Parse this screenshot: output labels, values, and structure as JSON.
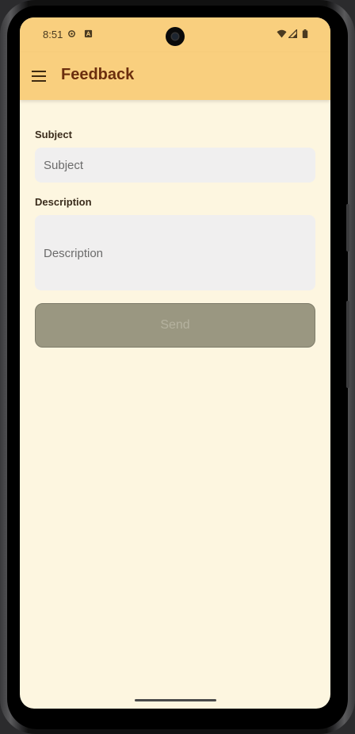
{
  "status_bar": {
    "time": "8:51",
    "left_icons": [
      "settings-icon",
      "accessibility-icon"
    ],
    "right_icons": [
      "wifi-icon",
      "signal-icon",
      "battery-icon"
    ]
  },
  "app_bar": {
    "title": "Feedback",
    "menu_icon": "hamburger-menu-icon"
  },
  "form": {
    "subject": {
      "label": "Subject",
      "placeholder": "Subject",
      "value": ""
    },
    "description": {
      "label": "Description",
      "placeholder": "Description",
      "value": ""
    },
    "send_label": "Send"
  },
  "colors": {
    "app_bar": "#f9cf7e",
    "background": "#fdf6e0",
    "title": "#6b2e0e",
    "button_disabled": "#9a9781"
  }
}
